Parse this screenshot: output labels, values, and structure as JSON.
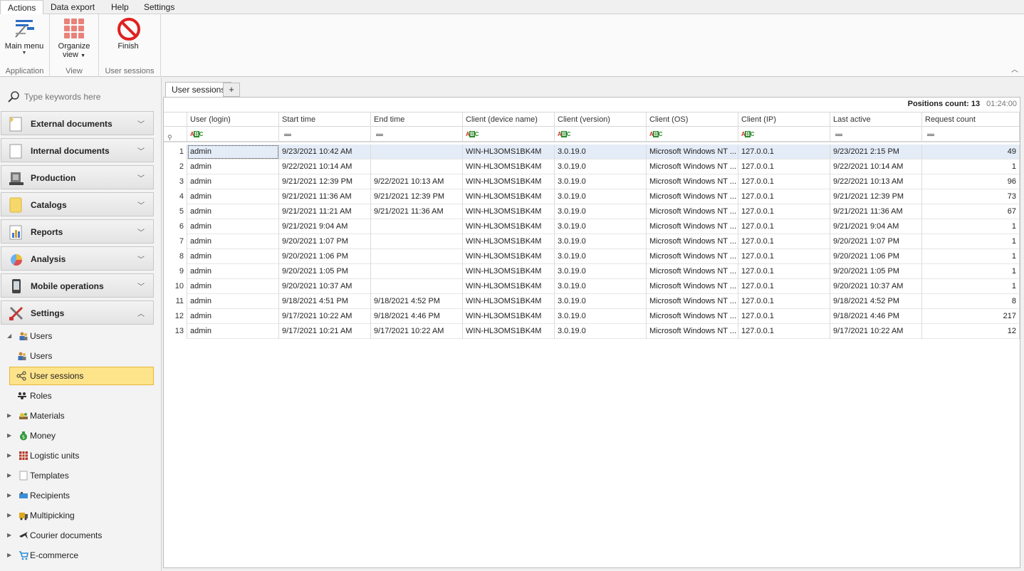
{
  "menu": {
    "tabs": [
      "Actions",
      "Data export",
      "Help",
      "Settings"
    ],
    "active": "Actions"
  },
  "ribbon": {
    "main_menu": "Main menu",
    "organize_view_1": "Organize",
    "organize_view_2": "view",
    "finish": "Finish",
    "group_application": "Application",
    "group_view": "View",
    "group_user_sessions": "User sessions"
  },
  "sidebar": {
    "search_placeholder": "Type keywords here",
    "groups": [
      {
        "label": "External documents",
        "icon": "external-documents-icon"
      },
      {
        "label": "Internal documents",
        "icon": "internal-documents-icon"
      },
      {
        "label": "Production",
        "icon": "production-icon"
      },
      {
        "label": "Catalogs",
        "icon": "catalogs-icon"
      },
      {
        "label": "Reports",
        "icon": "reports-icon"
      },
      {
        "label": "Analysis",
        "icon": "analysis-icon"
      },
      {
        "label": "Mobile operations",
        "icon": "mobile-operations-icon"
      },
      {
        "label": "Settings",
        "icon": "settings-icon"
      }
    ],
    "tree": [
      {
        "label": "Users",
        "level": 0,
        "expanded": true
      },
      {
        "label": "Users",
        "level": 1
      },
      {
        "label": "User sessions",
        "level": 1,
        "selected": true
      },
      {
        "label": "Roles",
        "level": 1
      },
      {
        "label": "Materials",
        "level": 0
      },
      {
        "label": "Money",
        "level": 0
      },
      {
        "label": "Logistic units",
        "level": 0
      },
      {
        "label": "Templates",
        "level": 0
      },
      {
        "label": "Recipients",
        "level": 0
      },
      {
        "label": "Multipicking",
        "level": 0
      },
      {
        "label": "Courier documents",
        "level": 0
      },
      {
        "label": "E-commerce",
        "level": 0
      }
    ]
  },
  "doc_tabs": {
    "active": "User sessions",
    "add": "+"
  },
  "grid": {
    "positions_label": "Positions count:",
    "positions_count": "13",
    "elapsed": "01:24:00",
    "columns": [
      "User (login)",
      "Start time",
      "End time",
      "Client (device name)",
      "Client (version)",
      "Client (OS)",
      "Client (IP)",
      "Last active",
      "Request count"
    ],
    "rows": [
      [
        "1",
        "admin",
        "9/23/2021 10:42 AM",
        "",
        "WIN-HL3OMS1BK4M",
        "3.0.19.0",
        "Microsoft Windows NT ...",
        "127.0.0.1",
        "9/23/2021 2:15 PM",
        "49"
      ],
      [
        "2",
        "admin",
        "9/22/2021 10:14 AM",
        "",
        "WIN-HL3OMS1BK4M",
        "3.0.19.0",
        "Microsoft Windows NT ...",
        "127.0.0.1",
        "9/22/2021 10:14 AM",
        "1"
      ],
      [
        "3",
        "admin",
        "9/21/2021 12:39 PM",
        "9/22/2021 10:13 AM",
        "WIN-HL3OMS1BK4M",
        "3.0.19.0",
        "Microsoft Windows NT ...",
        "127.0.0.1",
        "9/22/2021 10:13 AM",
        "96"
      ],
      [
        "4",
        "admin",
        "9/21/2021 11:36 AM",
        "9/21/2021 12:39 PM",
        "WIN-HL3OMS1BK4M",
        "3.0.19.0",
        "Microsoft Windows NT ...",
        "127.0.0.1",
        "9/21/2021 12:39 PM",
        "73"
      ],
      [
        "5",
        "admin",
        "9/21/2021 11:21 AM",
        "9/21/2021 11:36 AM",
        "WIN-HL3OMS1BK4M",
        "3.0.19.0",
        "Microsoft Windows NT ...",
        "127.0.0.1",
        "9/21/2021 11:36 AM",
        "67"
      ],
      [
        "6",
        "admin",
        "9/21/2021 9:04 AM",
        "",
        "WIN-HL3OMS1BK4M",
        "3.0.19.0",
        "Microsoft Windows NT ...",
        "127.0.0.1",
        "9/21/2021 9:04 AM",
        "1"
      ],
      [
        "7",
        "admin",
        "9/20/2021 1:07 PM",
        "",
        "WIN-HL3OMS1BK4M",
        "3.0.19.0",
        "Microsoft Windows NT ...",
        "127.0.0.1",
        "9/20/2021 1:07 PM",
        "1"
      ],
      [
        "8",
        "admin",
        "9/20/2021 1:06 PM",
        "",
        "WIN-HL3OMS1BK4M",
        "3.0.19.0",
        "Microsoft Windows NT ...",
        "127.0.0.1",
        "9/20/2021 1:06 PM",
        "1"
      ],
      [
        "9",
        "admin",
        "9/20/2021 1:05 PM",
        "",
        "WIN-HL3OMS1BK4M",
        "3.0.19.0",
        "Microsoft Windows NT ...",
        "127.0.0.1",
        "9/20/2021 1:05 PM",
        "1"
      ],
      [
        "10",
        "admin",
        "9/20/2021 10:37 AM",
        "",
        "WIN-HL3OMS1BK4M",
        "3.0.19.0",
        "Microsoft Windows NT ...",
        "127.0.0.1",
        "9/20/2021 10:37 AM",
        "1"
      ],
      [
        "11",
        "admin",
        "9/18/2021 4:51 PM",
        "9/18/2021 4:52 PM",
        "WIN-HL3OMS1BK4M",
        "3.0.19.0",
        "Microsoft Windows NT ...",
        "127.0.0.1",
        "9/18/2021 4:52 PM",
        "8"
      ],
      [
        "12",
        "admin",
        "9/17/2021 10:22 AM",
        "9/18/2021 4:46 PM",
        "WIN-HL3OMS1BK4M",
        "3.0.19.0",
        "Microsoft Windows NT ...",
        "127.0.0.1",
        "9/18/2021 4:46 PM",
        "217"
      ],
      [
        "13",
        "admin",
        "9/17/2021 10:21 AM",
        "9/17/2021 10:22 AM",
        "WIN-HL3OMS1BK4M",
        "3.0.19.0",
        "Microsoft Windows NT ...",
        "127.0.0.1",
        "9/17/2021 10:22 AM",
        "12"
      ]
    ],
    "filter_types": [
      "text",
      "equals",
      "equals",
      "text",
      "text",
      "text",
      "text",
      "equals",
      "equals"
    ],
    "selected_row": 1
  },
  "colors": {
    "selection_row": "#e4ecf7",
    "tree_selected": "#fde38a",
    "finish_icon": "#e02020"
  }
}
